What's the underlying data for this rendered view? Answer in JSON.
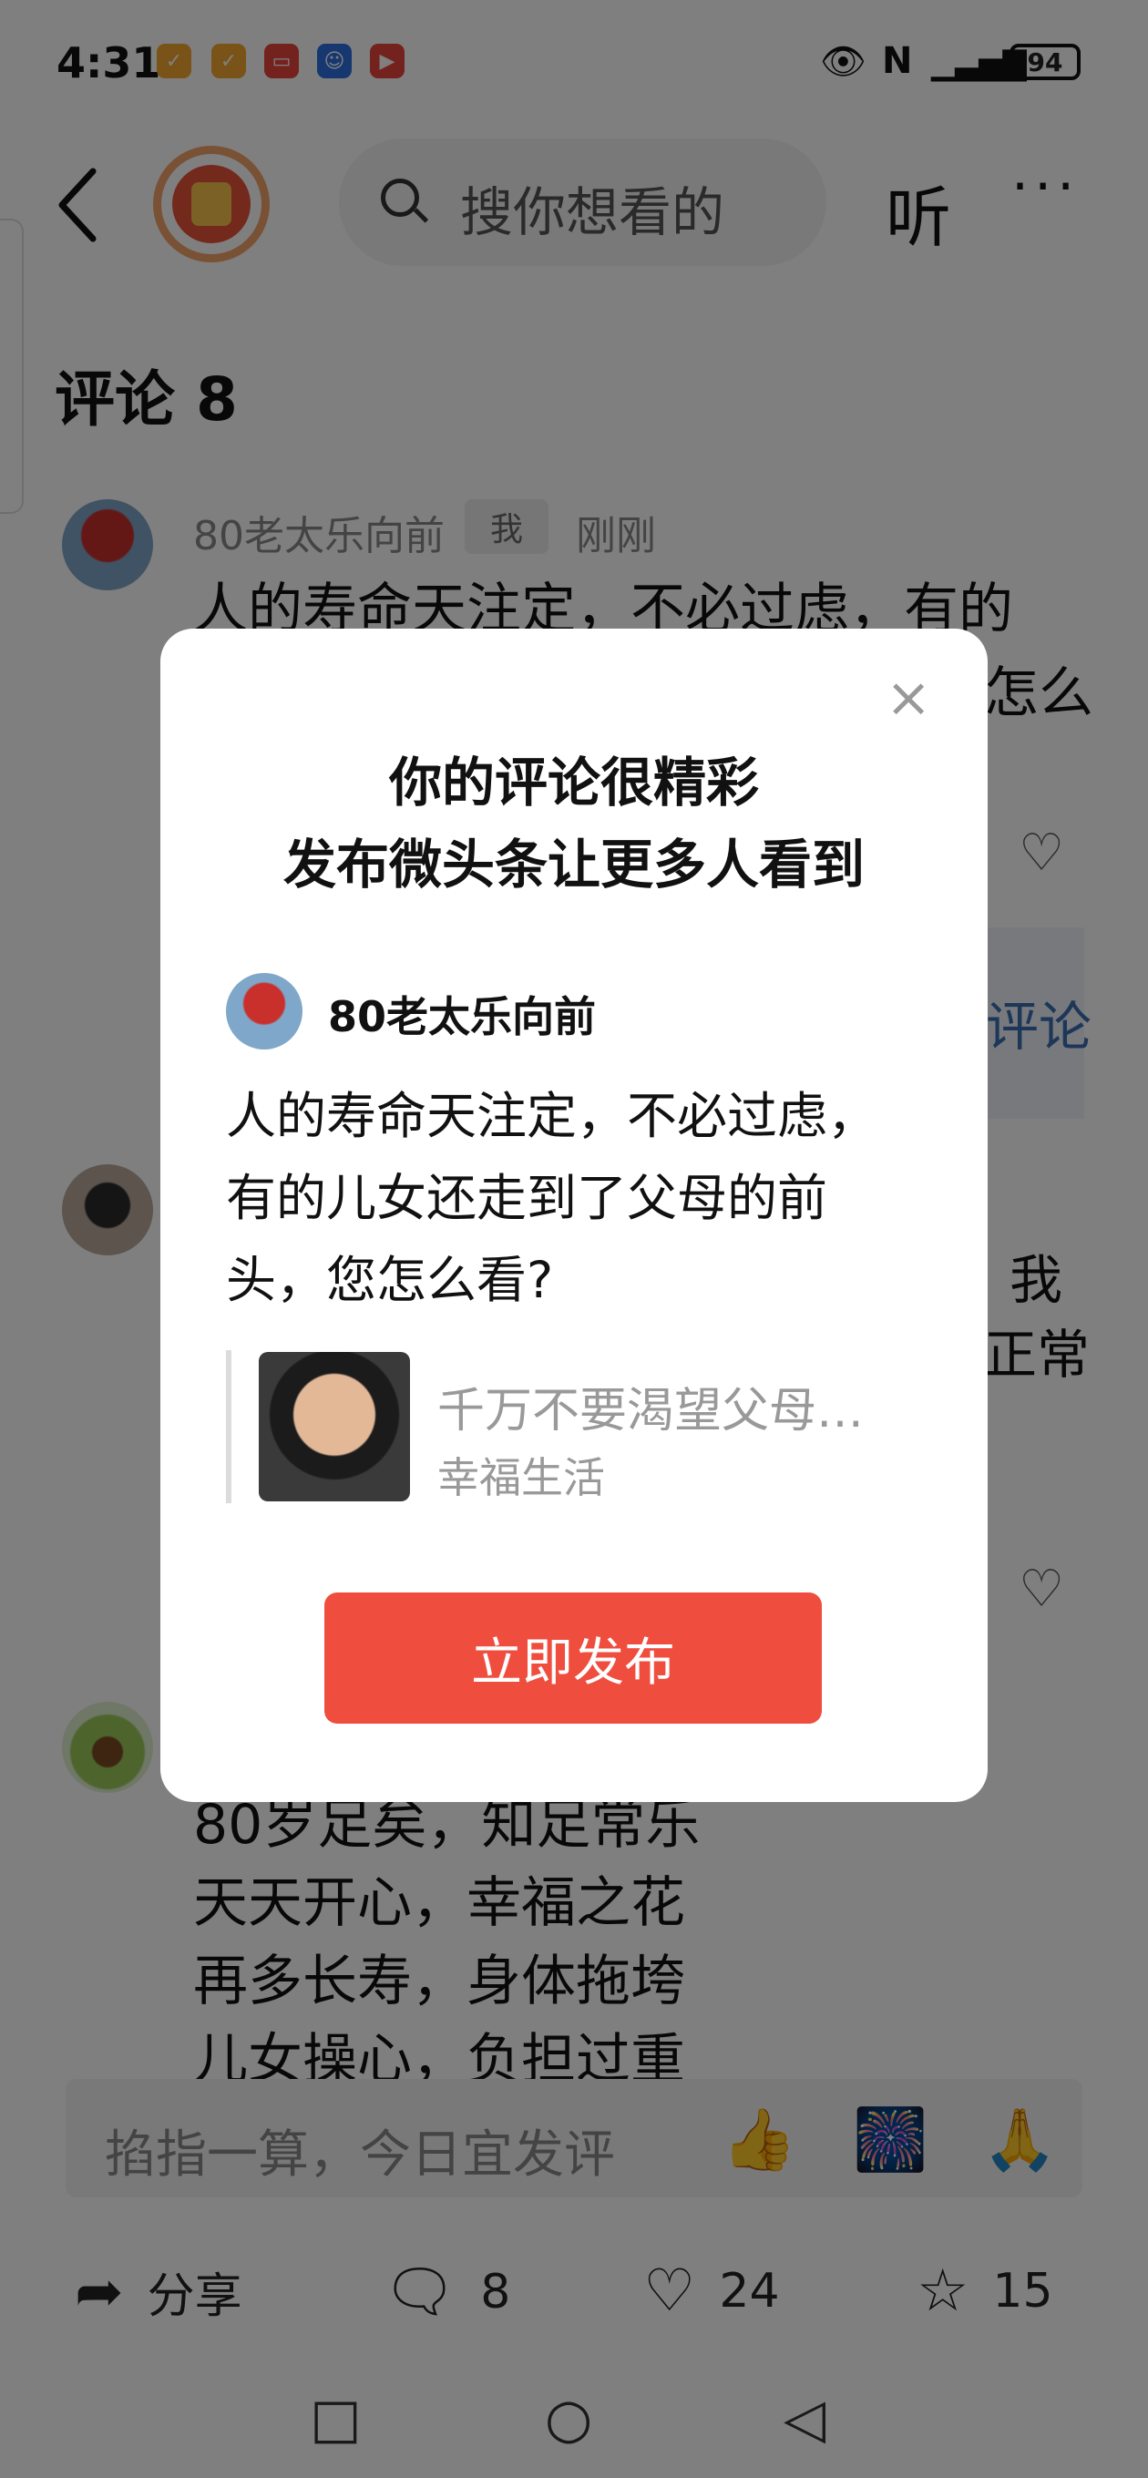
{
  "status_bar": {
    "time": "4:31",
    "battery": "94"
  },
  "header": {
    "search_placeholder": "搜你想看的",
    "listen_label": "听",
    "more_label": "···"
  },
  "comments": {
    "title": "评论 8",
    "first": {
      "author": "80老太乐向前",
      "me_tag": "我",
      "time": "刚刚",
      "text": "人的寿命天注定，不必过虑，有的",
      "text_hidden_tail": "怎么"
    },
    "reply_label": "评论",
    "second_partial": {
      "line1": "我",
      "line2": "正常"
    },
    "third": {
      "lines": [
        "80岁足矣，知足常乐",
        "天天开心，幸福之花",
        "再多长寿，身体拖垮",
        "儿女操心，负担过重"
      ]
    }
  },
  "input_bar": {
    "placeholder": "掐指一算，今日宜发评",
    "emojis": [
      "👍",
      "🎆",
      "🙏"
    ]
  },
  "bottom_bar": {
    "share": "分享",
    "comments": "8",
    "likes": "24",
    "favorites": "15"
  },
  "dialog": {
    "title_line1": "你的评论很精彩",
    "title_line2": "发布微头条让更多人看到",
    "author": "80老太乐向前",
    "text": "人的寿命天注定，不必过虑，有的儿女还走到了父母的前头，您怎么看?",
    "quote_title": "千万不要渴望父母…",
    "quote_source": "幸福生活",
    "publish_label": "立即发布",
    "close": "×"
  }
}
